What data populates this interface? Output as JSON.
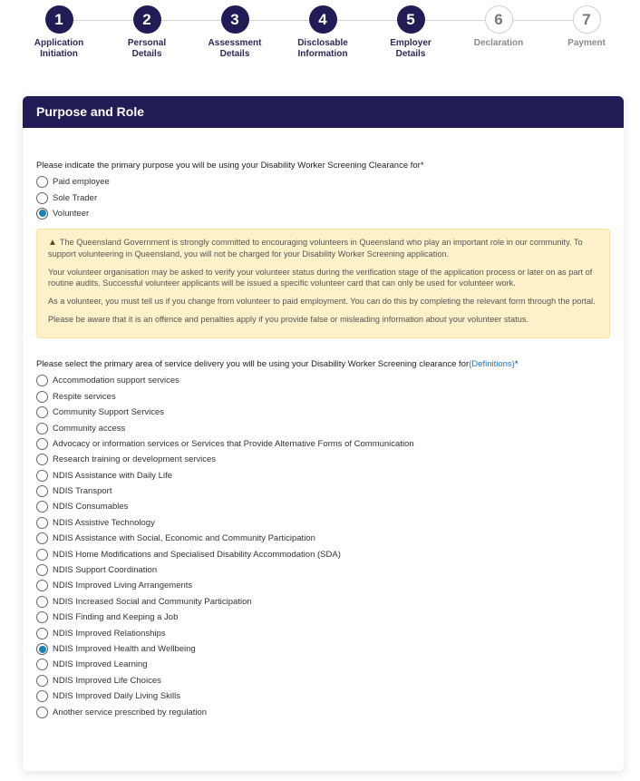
{
  "stepper": {
    "steps": [
      {
        "number": "1",
        "label_line1": "Application",
        "label_line2": "Initiation",
        "state": "done"
      },
      {
        "number": "2",
        "label_line1": "Personal",
        "label_line2": "Details",
        "state": "done"
      },
      {
        "number": "3",
        "label_line1": "Assessment",
        "label_line2": "Details",
        "state": "done"
      },
      {
        "number": "4",
        "label_line1": "Disclosable",
        "label_line2": "Information",
        "state": "done"
      },
      {
        "number": "5",
        "label_line1": "Employer",
        "label_line2": "Details",
        "state": "current"
      },
      {
        "number": "6",
        "label_line1": "Declaration",
        "label_line2": "",
        "state": "todo"
      },
      {
        "number": "7",
        "label_line1": "Payment",
        "label_line2": "",
        "state": "todo"
      }
    ]
  },
  "card": {
    "title": "Purpose and Role",
    "purpose_question": "Please indicate the primary purpose you will be using your Disability Worker Screening Clearance for*",
    "purpose_options": [
      {
        "label": "Paid employee",
        "checked": false
      },
      {
        "label": "Sole Trader",
        "checked": false
      },
      {
        "label": "Volunteer",
        "checked": true
      }
    ],
    "alert": {
      "icon": "warning-icon",
      "paragraphs": [
        "The Queensland Government is strongly committed to encouraging volunteers in Queensland who play an important role in our community. To support volunteering in Queensland, you will not be charged for your Disability Worker Screening application.",
        "Your volunteer organisation may be asked to verify your volunteer status during the verification stage of the application process or later on as part of routine audits. Successful volunteer applicants will be issued a specific volunteer card that can only be used for volunteer work.",
        "As a volunteer, you must tell us if you change from volunteer to paid employment. You can do this by completing the relevant form through the portal.",
        "Please be aware that it is an offence and penalties apply if you provide false or misleading information about your volunteer status."
      ]
    },
    "service_question_prefix": "Please select the primary area of service delivery you will be using your Disability Worker Screening clearance for",
    "service_question_link": "(Definitions)",
    "service_question_suffix": "*",
    "service_options": [
      {
        "label": "Accommodation support services",
        "checked": false
      },
      {
        "label": "Respite services",
        "checked": false
      },
      {
        "label": "Community Support Services",
        "checked": false
      },
      {
        "label": "Community access",
        "checked": false
      },
      {
        "label": "Advocacy or information services or Services that Provide Alternative Forms of Communication",
        "checked": false
      },
      {
        "label": "Research training or development services",
        "checked": false
      },
      {
        "label": "NDIS Assistance with Daily Life",
        "checked": false
      },
      {
        "label": "NDIS Transport",
        "checked": false
      },
      {
        "label": "NDIS Consumables",
        "checked": false
      },
      {
        "label": "NDIS Assistive Technology",
        "checked": false
      },
      {
        "label": "NDIS Assistance with Social, Economic and Community Participation",
        "checked": false
      },
      {
        "label": "NDIS Home Modifications and Specialised Disability Accommodation (SDA)",
        "checked": false
      },
      {
        "label": "NDIS Support Coordination",
        "checked": false
      },
      {
        "label": "NDIS Improved Living Arrangements",
        "checked": false
      },
      {
        "label": "NDIS Increased Social and Community Participation",
        "checked": false
      },
      {
        "label": "NDIS Finding and Keeping a Job",
        "checked": false
      },
      {
        "label": "NDIS Improved Relationships",
        "checked": false
      },
      {
        "label": "NDIS Improved Health and Wellbeing",
        "checked": true
      },
      {
        "label": "NDIS Improved Learning",
        "checked": false
      },
      {
        "label": "NDIS Improved Life Choices",
        "checked": false
      },
      {
        "label": "NDIS Improved Daily Living Skills",
        "checked": false
      },
      {
        "label": "Another service prescribed by regulation",
        "checked": false
      }
    ]
  },
  "colors": {
    "brand_navy": "#211c55",
    "radio_selected": "#1c7fb8",
    "alert_bg": "#fdf1c9",
    "link": "#1a73c8"
  }
}
